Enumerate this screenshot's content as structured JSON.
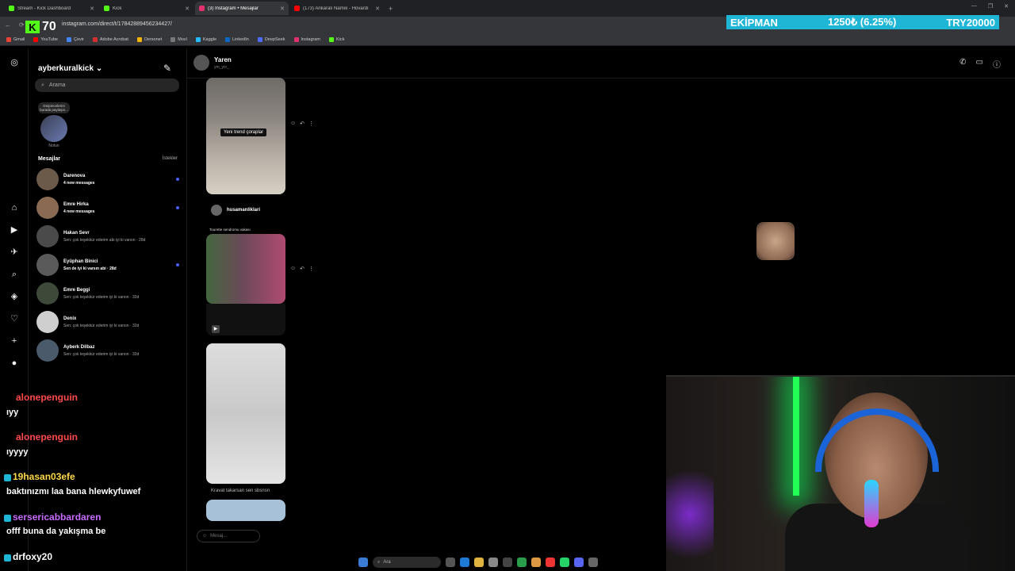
{
  "browser": {
    "tabs": [
      {
        "title": "Stream - Kick Dashboard",
        "color": "#53fc18",
        "active": false
      },
      {
        "title": "Kick",
        "color": "#53fc18",
        "active": false
      },
      {
        "title": "(3) Instagram • Mesajlar",
        "color": "#e1306c",
        "active": true
      },
      {
        "title": "(173) Ankaralı Namık - Hovardı",
        "color": "#ff0000",
        "active": false
      }
    ],
    "url": "instagram.com/direct/t/17842889456234427/",
    "bookmarks": [
      "Gmail",
      "YouTube",
      "Çevir",
      "Adobe Acrobat",
      "Dersonet",
      "Mısıl",
      "Kaggle",
      "LinkedIn",
      "DeepSeek",
      "Instagram",
      "Kick"
    ]
  },
  "kick_overlay": {
    "number": "70"
  },
  "ticker": {
    "left": "EKİPMAN",
    "middle": "1250₺ (6.25%)",
    "right": "TRY20000"
  },
  "inbox": {
    "username": "ayberkuralkick",
    "search_placeholder": "Arama",
    "note": {
      "text": "Düşüncelerini burada paylaşın...",
      "label": "Notun"
    },
    "messages_title": "Mesajlar",
    "requests_label": "İstekler",
    "conversations": [
      {
        "name": "Darenova",
        "preview": "4 new messages",
        "bold": true,
        "unread": true,
        "color": "#6b5a4a"
      },
      {
        "name": "Emre Hirka",
        "preview": "4 new messages",
        "bold": true,
        "unread": true,
        "color": "#8a6a52"
      },
      {
        "name": "Hakan Sevr",
        "preview": "Sen: çok teşekkür ederim abi iyi ki varsın · 28d",
        "bold": false,
        "unread": false,
        "color": "#4a4a4a"
      },
      {
        "name": "Eyüphan Binici",
        "preview": "Sen de iyi ki varsın abi · 28d",
        "bold": true,
        "unread": true,
        "color": "#5a5a5a"
      },
      {
        "name": "Emre Beggi",
        "preview": "Sen: çok teşekkür ederim iyi ki varsın · 32d",
        "bold": false,
        "unread": false,
        "color": "#3d4a3a"
      },
      {
        "name": "Denix",
        "preview": "Sen: çok teşekkür ederim iyi ki varsın · 32d",
        "bold": false,
        "unread": false,
        "color": "#cfcfcf"
      },
      {
        "name": "Ayberk Dilbaz",
        "preview": "Sen: çok teşekkür ederim iyi ki varsın · 32d",
        "bold": false,
        "unread": false,
        "color": "#4a5a6a"
      }
    ]
  },
  "chat_header": {
    "name": "Yaren",
    "handle": "ym_ycr_"
  },
  "thread": {
    "caption1": "Yeni trend çoraplar",
    "share_account": "husamanliklari",
    "share_caption": "Tourette sendromu vakası",
    "caption3": "Kravat takarsan sen sbsnsn",
    "input_placeholder": "Mesaj..."
  },
  "stream_chat": [
    {
      "user": "alonepenguin",
      "color": "#ff4a4a",
      "text": "ıyy"
    },
    {
      "user": "alonepenguin",
      "color": "#ff4a4a",
      "text": "ıyyyy"
    },
    {
      "user": "19hasan03efe",
      "color": "#ffd84a",
      "text": "baktınızmı laa bana hlewkyfuwef"
    },
    {
      "user": "sersericabbardaren",
      "color": "#c86bff",
      "text": "offf buna da yakışma be"
    },
    {
      "user": "drfoxy20",
      "color": "#ffffff",
      "text": ""
    }
  ],
  "taskbar": {
    "search_placeholder": "Ara"
  }
}
